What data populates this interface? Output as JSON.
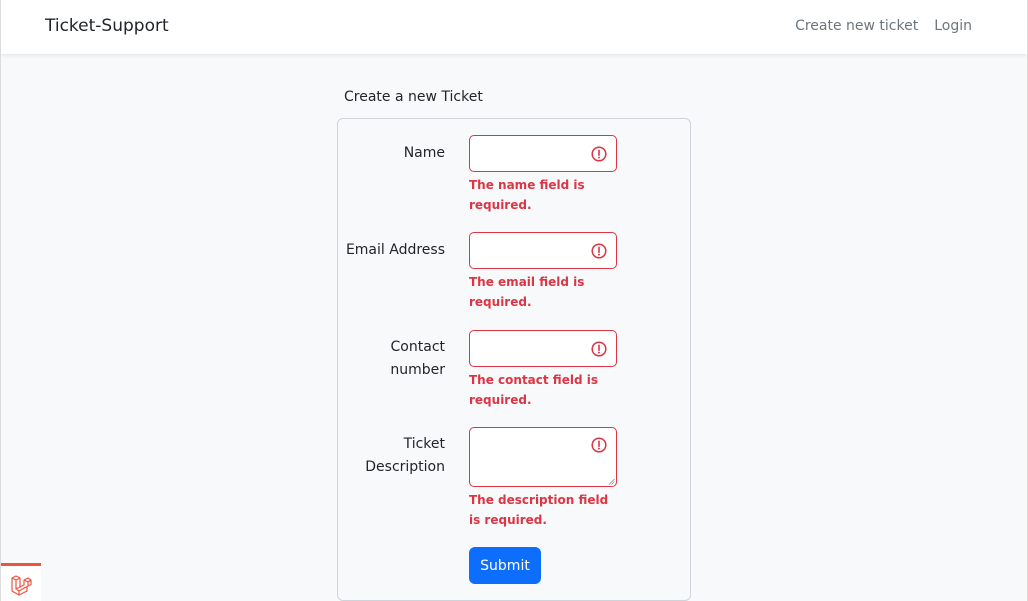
{
  "navbar": {
    "brand": "Ticket-Support",
    "links": [
      {
        "label": "Create new ticket"
      },
      {
        "label": "Login"
      }
    ]
  },
  "form": {
    "header": "Create a new Ticket",
    "fields": [
      {
        "label": "Name",
        "value": "",
        "error": "The name field is required."
      },
      {
        "label": "Email Address",
        "value": "",
        "error": "The email field is required."
      },
      {
        "label": "Contact number",
        "value": "",
        "error": "The contact field is required."
      },
      {
        "label": "Ticket Description",
        "value": "",
        "error": "The description field is required."
      }
    ],
    "submit_label": "Submit"
  },
  "icons": {
    "field_error": "exclamation-circle-icon",
    "debugbar": "laravel-logo-icon"
  },
  "colors": {
    "error": "#dc3545",
    "primary": "#0d6efd",
    "debug_accent": "#f05340"
  }
}
